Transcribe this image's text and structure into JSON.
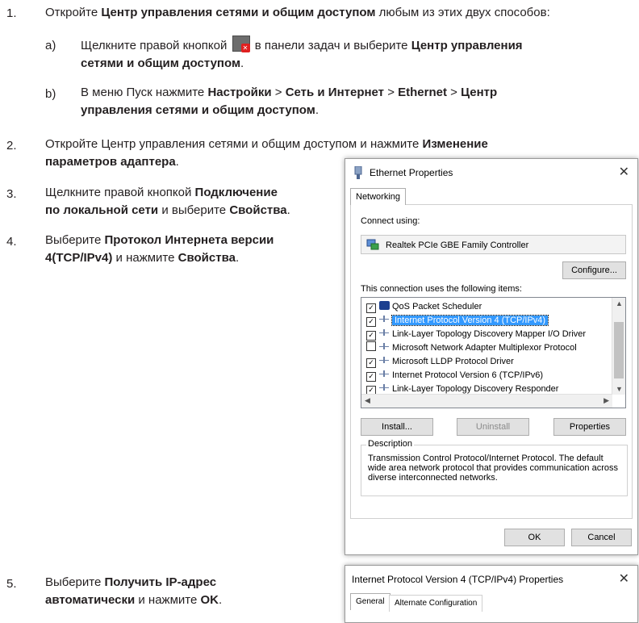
{
  "steps": [
    {
      "number": "1.",
      "pre": "Откройте ",
      "bold1": "Центр управления сетями и общим доступом",
      "post": " любым из этих двух способов:"
    },
    {
      "number": "2.",
      "line1": "Откройте Центр управления сетями и общим доступом и нажмите ",
      "bold_a": "Изменение",
      "bold_b": "параметров адаптера",
      "end": "."
    },
    {
      "number": "3.",
      "pre": "Щелкните правой кнопкой ",
      "bold_a": "Подключение",
      "bold_b": "по локальной сети",
      "mid": " и выберите ",
      "bold_c": "Свойства",
      "end": "."
    },
    {
      "number": "4.",
      "pre": "Выберите ",
      "bold_a": "Протокол Интернета версии",
      "bold_b": "4(TCP/IPv4)",
      "mid": " и нажмите ",
      "bold_c": "Свойства",
      "end": "."
    },
    {
      "number": "5.",
      "pre": "Выберите ",
      "bold_a": "Получить IP-адрес",
      "bold_b": "автоматически",
      "mid": " и нажмите ",
      "bold_c": "OK",
      "end": "."
    }
  ],
  "substeps": [
    {
      "letter": "a)",
      "pre": "Щелкните правой кнопкой ",
      "post": " в панели задач и выберите ",
      "bold_a": "Центр управления",
      "bold_b": "сетями и общим доступом",
      "end": "."
    },
    {
      "letter": "b)",
      "pre": "В меню Пуск нажмите ",
      "b1": "Настройки",
      "sep": " > ",
      "b2": "Сеть и Интернет",
      "b3": "Ethernet",
      "b4": "Центр",
      "b5": "управления сетями и общим доступом",
      "end": "."
    }
  ],
  "dialog1": {
    "title": "Ethernet Properties",
    "tab": "Networking",
    "connect_using": "Connect using:",
    "adapter": "Realtek PCIe GBE Family Controller",
    "configure": "Configure...",
    "items_label": "This connection uses the following items:",
    "items": [
      {
        "label": "QoS Packet Scheduler",
        "checked": "✓"
      },
      {
        "label": "Internet Protocol Version 4 (TCP/IPv4)",
        "checked": "✓"
      },
      {
        "label": "Link-Layer Topology Discovery Mapper I/O Driver",
        "checked": "✓"
      },
      {
        "label": "Microsoft Network Adapter Multiplexor Protocol",
        "checked": ""
      },
      {
        "label": "Microsoft LLDP Protocol Driver",
        "checked": "✓"
      },
      {
        "label": "Internet Protocol Version 6 (TCP/IPv6)",
        "checked": "✓"
      },
      {
        "label": "Link-Layer Topology Discovery Responder",
        "checked": "✓"
      }
    ],
    "install": "Install...",
    "uninstall": "Uninstall",
    "properties": "Properties",
    "description_title": "Description",
    "description": "Transmission Control Protocol/Internet Protocol. The default wide area network protocol that provides communication across diverse interconnected networks.",
    "ok": "OK",
    "cancel": "Cancel"
  },
  "dialog2": {
    "title": "Internet Protocol Version 4 (TCP/IPv4) Properties",
    "tab": "General",
    "tab2": "Alternate Configuration"
  }
}
